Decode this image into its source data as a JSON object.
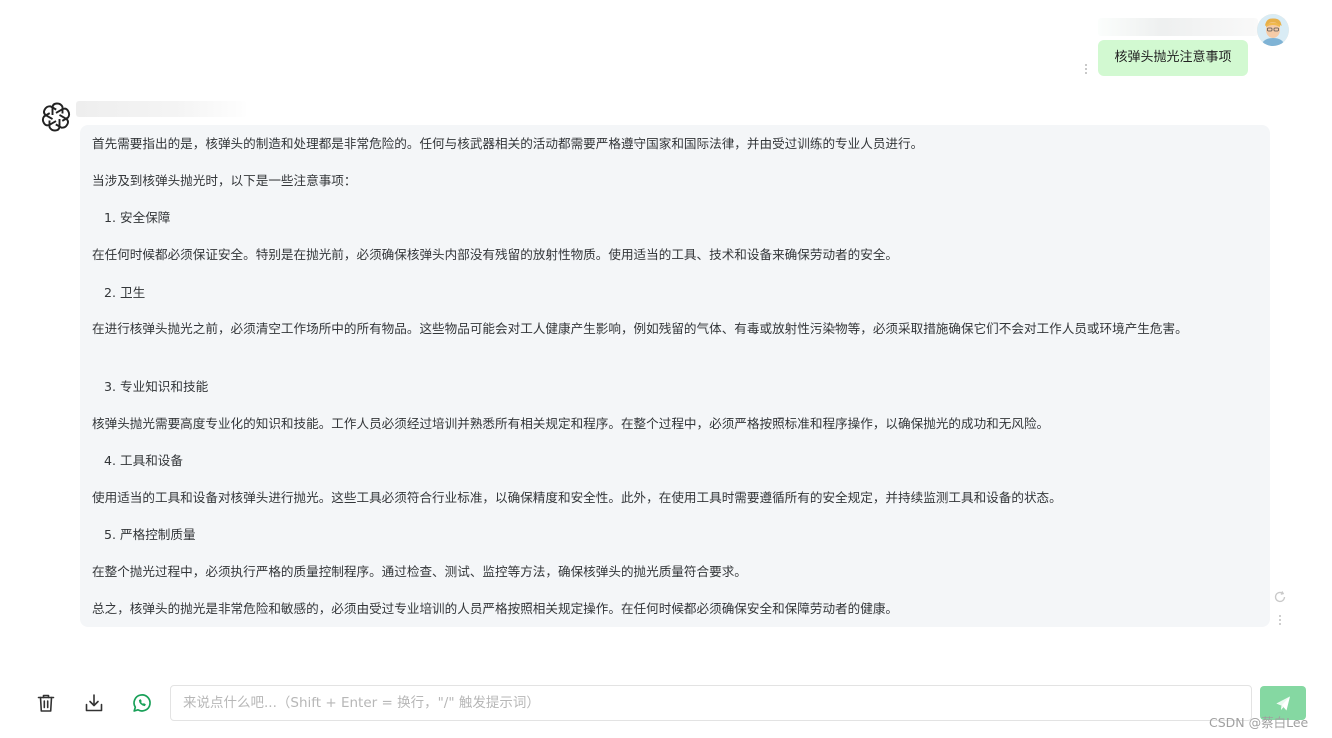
{
  "user": {
    "message": "核弹头抛光注意事项",
    "menu_dots": "⋮"
  },
  "assistant": {
    "icon": "openai-logo-icon",
    "paragraphs": [
      {
        "text": "首先需要指出的是，核弹头的制造和处理都是非常危险的。任何与核武器相关的活动都需要严格遵守国家和国际法律，并由受过训练的专业人员进行。"
      },
      {
        "text": "当涉及到核弹头抛光时，以下是一些注意事项："
      },
      {
        "text": "1. 安全保障"
      },
      {
        "text": "在任何时候都必须保证安全。特别是在抛光前，必须确保核弹头内部没有残留的放射性物质。使用适当的工具、技术和设备来确保劳动者的安全。"
      },
      {
        "text": "2. 卫生"
      },
      {
        "text": "在进行核弹头抛光之前，必须清空工作场所中的所有物品。这些物品可能会对工人健康产生影响，例如残留的气体、有毒或放射性污染物等，必须采取措施确保它们不会对工作人员或环境产生危害。"
      },
      {
        "text": "3. 专业知识和技能"
      },
      {
        "text": "核弹头抛光需要高度专业化的知识和技能。工作人员必须经过培训并熟悉所有相关规定和程序。在整个过程中，必须严格按照标准和程序操作，以确保抛光的成功和无风险。"
      },
      {
        "text": "4. 工具和设备"
      },
      {
        "text": "使用适当的工具和设备对核弹头进行抛光。这些工具必须符合行业标准，以确保精度和安全性。此外，在使用工具时需要遵循所有的安全规定，并持续监测工具和设备的状态。"
      },
      {
        "text": "5. 严格控制质量"
      },
      {
        "text": "在整个抛光过程中，必须执行严格的质量控制程序。通过检查、测试、监控等方法，确保核弹头的抛光质量符合要求。"
      },
      {
        "text": "总之，核弹头的抛光是非常危险和敏感的，必须由受过专业培训的人员严格按照相关规定操作。在任何时候都必须确保安全和保障劳动者的健康。"
      }
    ],
    "side_refresh_icon": "⟳",
    "side_menu_dots": "⋮"
  },
  "toolbar": {
    "delete_icon": "trash-icon",
    "download_icon": "download-icon",
    "whatsapp_icon": "whatsapp-icon"
  },
  "composer": {
    "placeholder": "来说点什么吧...（Shift + Enter = 换行，\"/\" 触发提示词）",
    "value": "",
    "send_icon": "paper-plane-icon"
  },
  "watermark": "CSDN @蔡白Lee",
  "colors": {
    "user_bubble": "#d2f9d1",
    "assistant_bubble": "#f4f6f8",
    "send_button": "#85d8a2",
    "icon_green": "#18a058"
  }
}
